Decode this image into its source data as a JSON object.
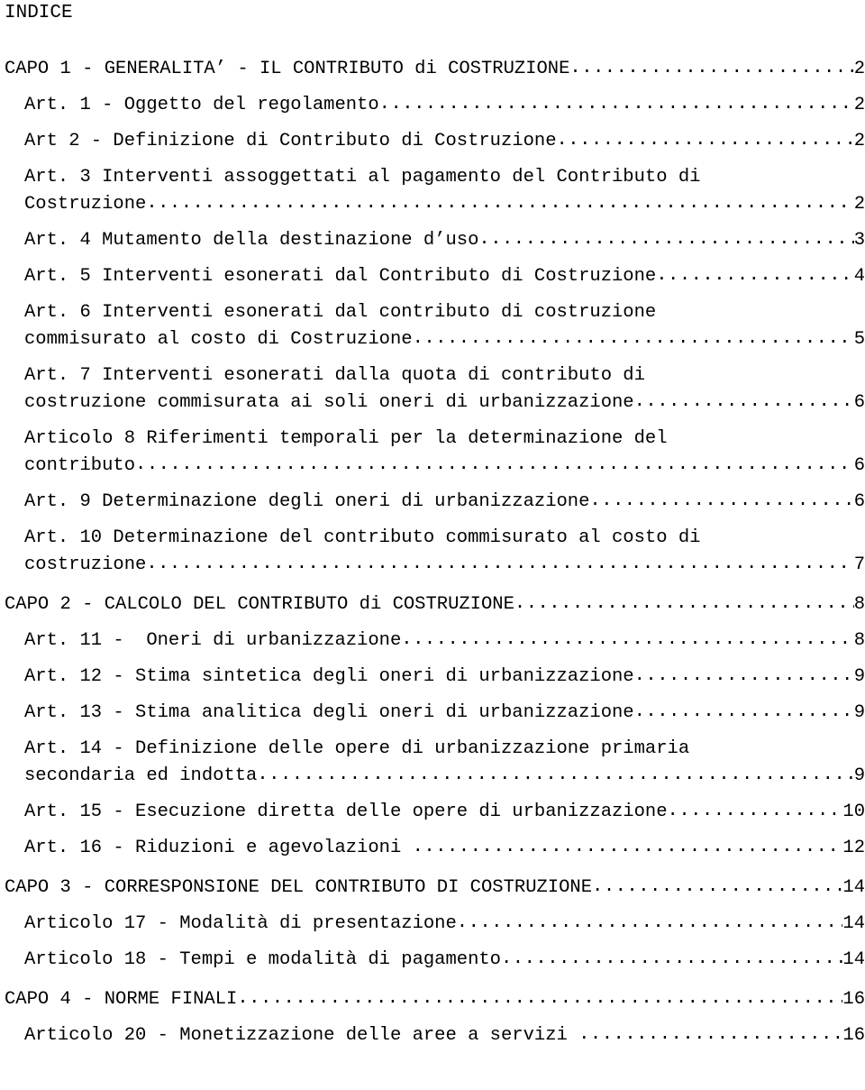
{
  "document": {
    "title": "INDICE",
    "font_color": "#000000",
    "background_color": "#ffffff"
  },
  "toc": {
    "entries": [
      {
        "id": "capo-1",
        "level": 1,
        "lines": [
          "CAPO 1 - GENERALITA’ - IL CONTRIBUTO di COSTRUZIONE"
        ],
        "page": "2",
        "gap_before": false
      },
      {
        "id": "art-1",
        "level": 2,
        "lines": [
          "Art. 1 - Oggetto del regolamento"
        ],
        "page": "2",
        "gap_before": false
      },
      {
        "id": "art-2",
        "level": 2,
        "lines": [
          "Art 2 - Definizione di Contributo di Costruzione"
        ],
        "page": "2",
        "gap_before": false
      },
      {
        "id": "art-3",
        "level": 2,
        "lines": [
          "Art. 3 Interventi assoggettati al pagamento del Contributo di",
          "Costruzione"
        ],
        "page": "2",
        "gap_before": false
      },
      {
        "id": "art-4",
        "level": 2,
        "lines": [
          "Art. 4 Mutamento della destinazione d’uso"
        ],
        "page": "3",
        "gap_before": false
      },
      {
        "id": "art-5",
        "level": 2,
        "lines": [
          "Art. 5 Interventi esonerati dal Contributo di Costruzione"
        ],
        "page": "4",
        "gap_before": false
      },
      {
        "id": "art-6",
        "level": 2,
        "lines": [
          "Art. 6 Interventi esonerati dal contributo di costruzione",
          "commisurato al costo di Costruzione"
        ],
        "page": "5",
        "gap_before": false
      },
      {
        "id": "art-7",
        "level": 2,
        "lines": [
          "Art. 7 Interventi esonerati dalla quota di contributo di",
          "costruzione commisurata ai soli oneri di urbanizzazione"
        ],
        "page": "6",
        "gap_before": false
      },
      {
        "id": "articolo-8",
        "level": 2,
        "lines": [
          "Articolo 8 Riferimenti temporali per la determinazione del",
          "contributo"
        ],
        "page": "6",
        "gap_before": false
      },
      {
        "id": "art-9",
        "level": 2,
        "lines": [
          "Art. 9 Determinazione degli oneri di urbanizzazione"
        ],
        "page": "6",
        "gap_before": false
      },
      {
        "id": "art-10",
        "level": 2,
        "lines": [
          "Art. 10 Determinazione del contributo commisurato al costo di",
          "costruzione"
        ],
        "page": "7",
        "gap_before": false
      },
      {
        "id": "capo-2",
        "level": 1,
        "lines": [
          "CAPO 2 - CALCOLO DEL CONTRIBUTO di COSTRUZIONE"
        ],
        "page": "8",
        "gap_before": true
      },
      {
        "id": "art-11",
        "level": 2,
        "lines": [
          "Art. 11 -  Oneri di urbanizzazione"
        ],
        "page": "8",
        "gap_before": false
      },
      {
        "id": "art-12",
        "level": 2,
        "lines": [
          "Art. 12 - Stima sintetica degli oneri di urbanizzazione"
        ],
        "page": "9",
        "gap_before": false
      },
      {
        "id": "art-13",
        "level": 2,
        "lines": [
          "Art. 13 - Stima analitica degli oneri di urbanizzazione"
        ],
        "page": "9",
        "gap_before": false
      },
      {
        "id": "art-14",
        "level": 2,
        "lines": [
          "Art. 14 - Definizione delle opere di urbanizzazione primaria",
          "secondaria ed indotta"
        ],
        "page": "9",
        "gap_before": false
      },
      {
        "id": "art-15",
        "level": 2,
        "lines": [
          "Art. 15 - Esecuzione diretta delle opere di urbanizzazione"
        ],
        "page": "10",
        "gap_before": false
      },
      {
        "id": "art-16",
        "level": 2,
        "lines": [
          "Art. 16 - Riduzioni e agevolazioni "
        ],
        "page": "12",
        "gap_before": false
      },
      {
        "id": "capo-3",
        "level": 1,
        "lines": [
          "CAPO 3 - CORRESPONSIONE DEL CONTRIBUTO DI COSTRUZIONE"
        ],
        "page": "14",
        "gap_before": true
      },
      {
        "id": "articolo-17",
        "level": 2,
        "lines": [
          "Articolo 17 - Modalità di presentazione"
        ],
        "page": "14",
        "gap_before": false
      },
      {
        "id": "articolo-18",
        "level": 2,
        "lines": [
          "Articolo 18 - Tempi e modalità di pagamento"
        ],
        "page": "14",
        "gap_before": false
      },
      {
        "id": "capo-4",
        "level": 1,
        "lines": [
          "CAPO 4 - NORME FINALI"
        ],
        "page": "16",
        "gap_before": true
      },
      {
        "id": "articolo-20",
        "level": 2,
        "lines": [
          "Articolo 20 - Monetizzazione delle aree a servizi "
        ],
        "page": "16",
        "gap_before": false
      }
    ]
  }
}
